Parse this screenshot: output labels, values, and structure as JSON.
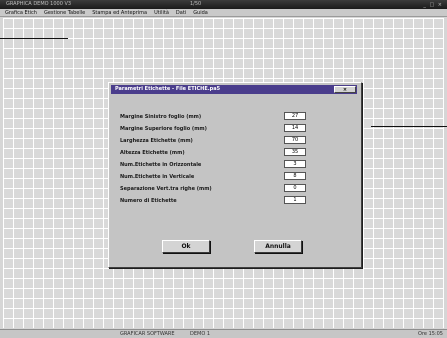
{
  "window": {
    "app_title": "GRAPHICA DEMO 1000 V3",
    "doc_title": "1/50",
    "controls": "_ □ ×"
  },
  "menu": [
    "Grafica Etich",
    "Gestione Tabelle",
    "Stampa ed Anteprima",
    "Utilità",
    "Dati",
    "Guida"
  ],
  "dialog": {
    "title": "Parametri Etichette  -  File ETICHE.pa5",
    "close_label": "×",
    "fields": [
      {
        "label": "Margine Sinistro foglio (mm)",
        "value": "27"
      },
      {
        "label": "Margine Superiore foglio (mm)",
        "value": "14"
      },
      {
        "label": "Larghezza Etichette (mm)",
        "value": "70"
      },
      {
        "label": "Altezza Etichette (mm)",
        "value": "35"
      },
      {
        "label": "Num.Etichette in Orizzontale",
        "value": "3"
      },
      {
        "label": "Num.Etichette in Verticale",
        "value": "8"
      },
      {
        "label": "Separazione Vert.tra righe (mm)",
        "value": "0"
      },
      {
        "label": "Numero di Etichette",
        "value": "1"
      }
    ],
    "ok_label": "Ok",
    "cancel_label": "Annulla"
  },
  "status": {
    "left": "GRAFICAR SOFTWARE",
    "mid": "DEMO 1",
    "right": "Ore 15:05"
  }
}
